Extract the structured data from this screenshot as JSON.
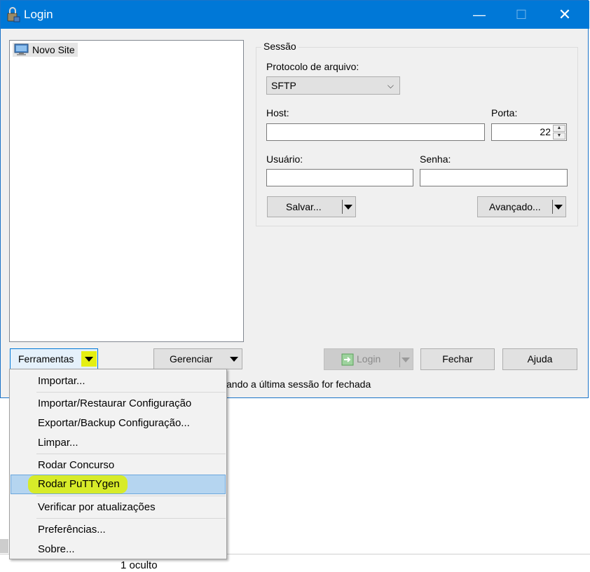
{
  "window": {
    "title": "Login",
    "minimize": "—",
    "maximize": "☐",
    "close": "✕"
  },
  "site_tree": {
    "items": [
      {
        "label": "Novo Site",
        "icon": "monitor-icon"
      }
    ]
  },
  "session": {
    "legend": "Sessão",
    "protocol_label": "Protocolo de arquivo:",
    "protocol_value": "SFTP",
    "host_label": "Host:",
    "host_value": "",
    "port_label": "Porta:",
    "port_value": "22",
    "user_label": "Usuário:",
    "user_value": "",
    "password_label": "Senha:",
    "password_value": "",
    "save_button": "Salvar...",
    "advanced_button": "Avançado..."
  },
  "bottom_buttons": {
    "tools": "Ferramentas",
    "manage": "Gerenciar",
    "login": "Login",
    "close": "Fechar",
    "help": "Ajuda"
  },
  "partial_checkbox_text": "ando a última sessão for fechada",
  "tools_menu": {
    "items": [
      "Importar...",
      "Importar/Restaurar Configuração",
      "Exportar/Backup Configuração...",
      "Limpar...",
      "Rodar Concurso",
      "Rodar PuTTYgen",
      "Verificar por atualizações",
      "Preferências...",
      "Sobre..."
    ],
    "highlighted_index": 5
  },
  "status": {
    "hidden_count": "1 oculto"
  },
  "colors": {
    "titlebar": "#0078d7",
    "highlight": "#b5d5f0",
    "marker": "#d9ec1e"
  }
}
